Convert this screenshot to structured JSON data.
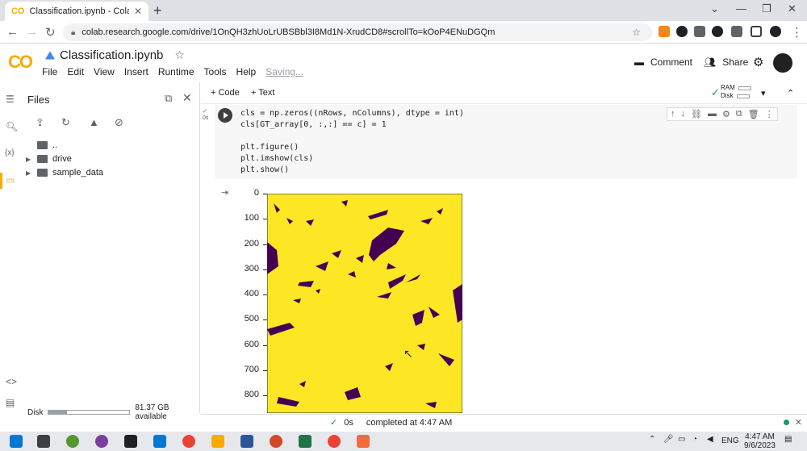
{
  "browser": {
    "tab_title": "Classification.ipynb - Colaborato",
    "url": "colab.research.google.com/drive/1OnQH3zhUoLrUBSBbl3I8Md1N-XrudCD8#scrollTo=kOoP4ENuDGQm"
  },
  "colab": {
    "logo": "CO",
    "notebook_title": "Classification.ipynb",
    "menu": [
      "File",
      "Edit",
      "View",
      "Insert",
      "Runtime",
      "Tools",
      "Help"
    ],
    "saving": "Saving...",
    "comment_label": "Comment",
    "share_label": "Share"
  },
  "files_panel": {
    "title": "Files",
    "items": [
      {
        "name": ".."
      },
      {
        "name": "drive"
      },
      {
        "name": "sample_data"
      }
    ],
    "disk_label": "Disk",
    "disk_available": "81.37 GB available",
    "disk_used_fraction": 0.23
  },
  "toolbar": {
    "code_label": "+ Code",
    "text_label": "+ Text",
    "ram_label": "RAM",
    "disk_label": "Disk"
  },
  "cell": {
    "exec_time": "0s",
    "code_lines": [
      "cls = np.zeros((nRows, nColumns), dtype = int)",
      "cls[GT_array[0, :,:] == c] = 1",
      "",
      "plt.figure()",
      "plt.imshow(cls)",
      "plt.show()"
    ]
  },
  "chart_data": {
    "type": "heatmap",
    "title": "",
    "xlabel": "",
    "ylabel": "",
    "ytick_labels": [
      "0",
      "100",
      "200",
      "300",
      "400",
      "500",
      "600",
      "700",
      "800"
    ],
    "ylim": [
      0,
      870
    ],
    "colormap": [
      "#440154",
      "#fde725"
    ],
    "values_description_classes": [
      0,
      1
    ]
  },
  "status": {
    "time": "0s",
    "completed": "completed at 4:47 AM"
  },
  "taskbar": {
    "lang": "ENG",
    "time": "4:47 AM",
    "date": "9/6/2023"
  },
  "colors": {
    "accent": "#f9ab00",
    "plot_bg": "#fde725",
    "plot_fg": "#440154",
    "run_ok": "#0f9d58"
  }
}
